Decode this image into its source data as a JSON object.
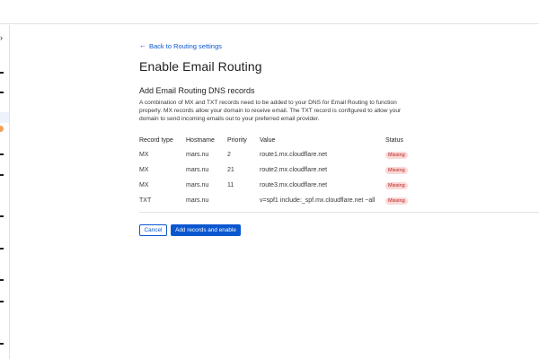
{
  "nav": {
    "back_icon": "arrow-left",
    "back_label": "Back to Routing settings"
  },
  "page": {
    "title": "Enable Email Routing",
    "section_title": "Add Email Routing DNS records",
    "description": "A combination of MX and TXT records need to be added to your DNS for Email Routing to function properly. MX records allow your domain to receive email. The TXT record is configured to allow your domain to send incoming emails out to your preferred email provider."
  },
  "table": {
    "headers": [
      "Record type",
      "Hostname",
      "Priority",
      "Value",
      "Status"
    ],
    "rows": [
      [
        "MX",
        "mars.nu",
        "2",
        "route1.mx.cloudflare.net",
        "Missing"
      ],
      [
        "MX",
        "mars.nu",
        "21",
        "route2.mx.cloudflare.net",
        "Missing"
      ],
      [
        "MX",
        "mars.nu",
        "11",
        "route3.mx.cloudflare.net",
        "Missing"
      ],
      [
        "TXT",
        "mars.nu",
        "",
        "v=spf1 include:_spf.mx.cloudflare.net ~all",
        "Missing"
      ]
    ]
  },
  "actions": {
    "cancel_label": "Cancel",
    "primary_label": "Add records and enable"
  },
  "colors": {
    "accent": "#0b57d0",
    "missing_bg": "#fbd8d8",
    "missing_text": "#b3261e"
  }
}
